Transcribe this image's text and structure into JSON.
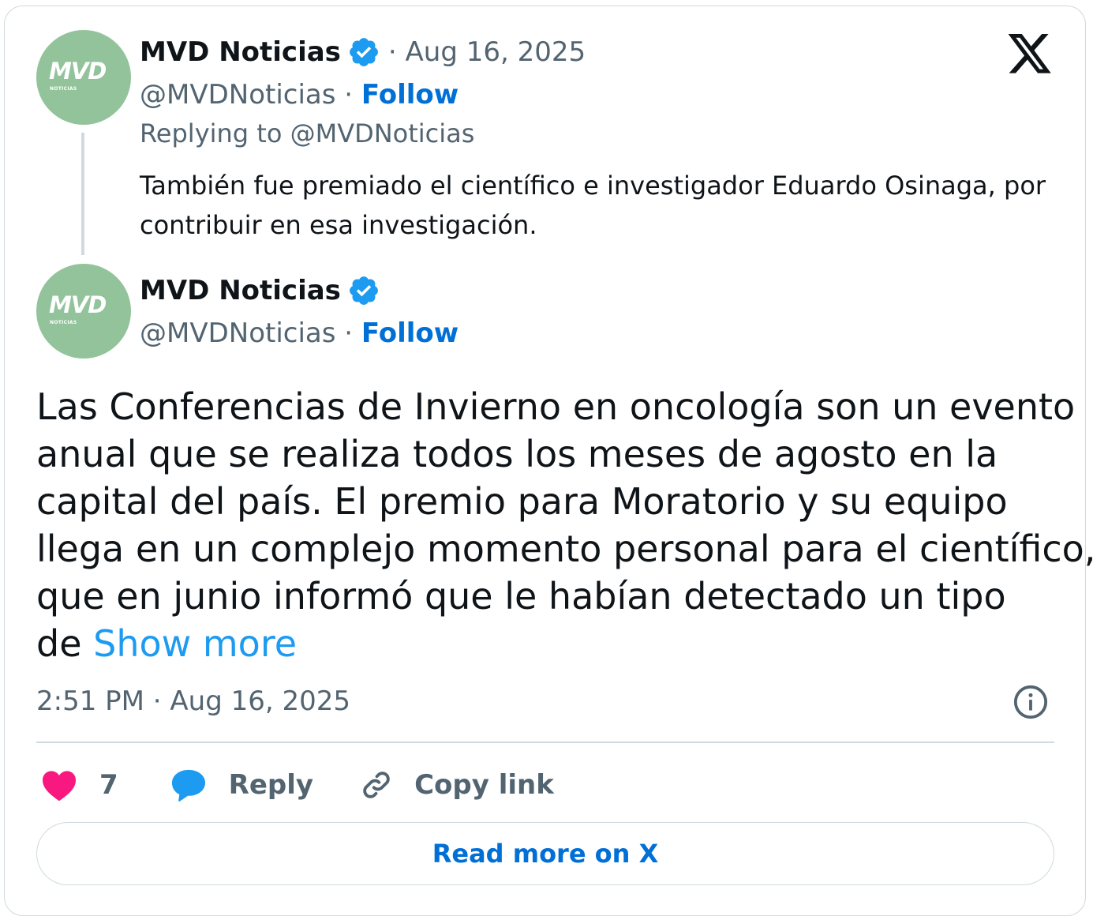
{
  "reply_tweet": {
    "avatar_text": "MVD",
    "avatar_subtext": "NOTICIAS",
    "author_name": "MVD Noticias",
    "date": "Aug 16, 2025",
    "handle": "@MVDNoticias",
    "follow_label": "Follow",
    "replying_to": "Replying to @MVDNoticias",
    "text": "También fue premiado el científico e investigador Eduardo Osinaga, por contribuir en esa investigación."
  },
  "main_tweet": {
    "avatar_text": "MVD",
    "avatar_subtext": "NOTICIAS",
    "author_name": "MVD Noticias",
    "handle": "@MVDNoticias",
    "follow_label": "Follow",
    "text_lines": [
      "Las Conferencias de Invierno en oncología son un evento",
      "anual que se realiza todos los meses de agosto en la",
      "capital del país. El premio para Moratorio y su equipo",
      "llega en un complejo momento personal para el científico,",
      "que en junio informó que le habían detectado un tipo",
      "de"
    ],
    "show_more_label": "Show more",
    "timestamp": "2:51 PM · Aug 16, 2025"
  },
  "actions": {
    "like_count": "7",
    "reply_label": "Reply",
    "copy_link_label": "Copy link"
  },
  "read_more_label": "Read more on X",
  "icons": {
    "verified": "verified-badge-icon",
    "platform": "x-logo-icon",
    "info": "info-icon",
    "like": "heart-icon",
    "reply": "speech-bubble-icon",
    "copy": "link-icon"
  },
  "colors": {
    "follow": "#006fd6",
    "show_more": "#1d9bf0",
    "verified": "#1d9bf0",
    "heart": "#f91880",
    "reply_bubble": "#1d9bf0",
    "avatar_bg": "#93c39a"
  }
}
